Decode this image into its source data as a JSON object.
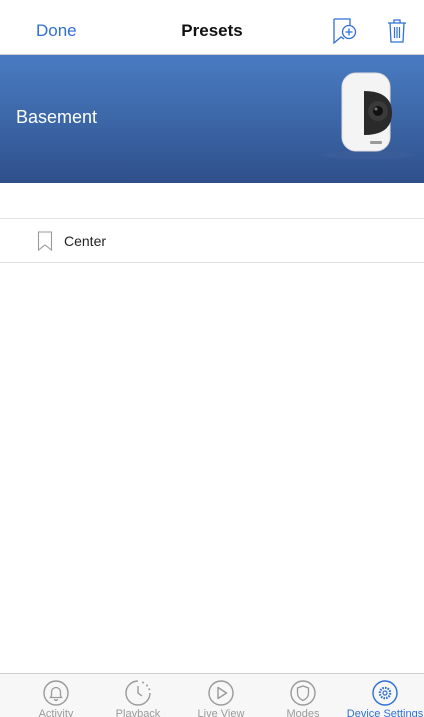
{
  "nav": {
    "done_label": "Done",
    "title": "Presets",
    "add_icon": "add-bookmark-icon",
    "delete_icon": "trash-icon"
  },
  "hero": {
    "camera_name": "Basement"
  },
  "presets": [
    {
      "label": "Center",
      "icon": "bookmark-icon"
    }
  ],
  "tabs": [
    {
      "label": "Activity",
      "icon": "bell-icon",
      "active": false
    },
    {
      "label": "Playback",
      "icon": "clock-icon",
      "active": false
    },
    {
      "label": "Live View",
      "icon": "play-icon",
      "active": false
    },
    {
      "label": "Modes",
      "icon": "shield-icon",
      "active": false
    },
    {
      "label": "Device Settings",
      "icon": "gear-icon",
      "active": true
    }
  ],
  "colors": {
    "accent": "#2f6fd6",
    "hero_top": "#4a7bc2",
    "hero_bottom": "#2f4f8a",
    "inactive_tab": "#9a9a9a"
  }
}
